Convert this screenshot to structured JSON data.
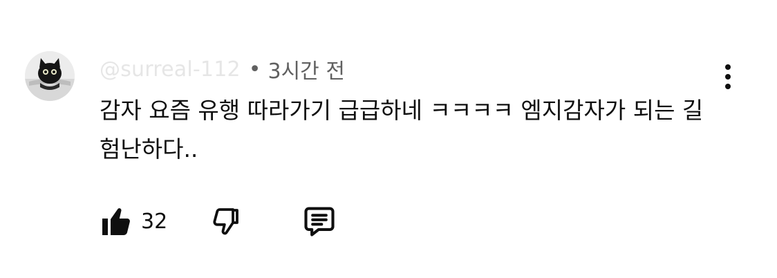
{
  "comment": {
    "author_handle": "@surreal-112",
    "separator": "•",
    "timestamp": "3시간 전",
    "text": "감자 요즘 유행 따라가기 급급하네 ㅋㅋㅋㅋ 엠지감자가 되는 길 험난하다..",
    "like_count": "32"
  },
  "icons": {
    "avatar": "black-cat-avatar",
    "like": "thumbs-up-filled-icon",
    "dislike": "thumbs-down-outline-icon",
    "reply": "comment-bubble-icon",
    "more": "vertical-ellipsis-icon"
  },
  "colors": {
    "text_primary": "#0f0f0f",
    "text_secondary": "#606060",
    "handle_faded": "#e6e6e6",
    "background": "#ffffff"
  }
}
